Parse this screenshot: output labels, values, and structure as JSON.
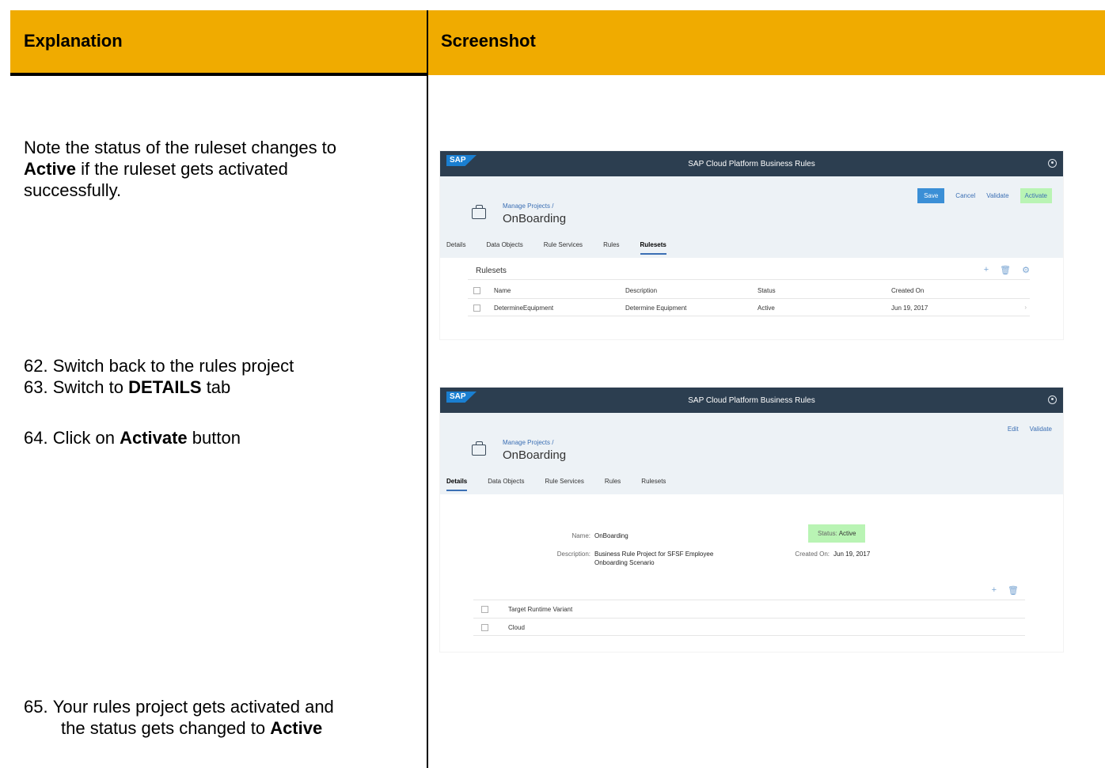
{
  "doc": {
    "header_explanation": "Explanation",
    "header_screenshot": "Screenshot",
    "note": {
      "prefix": "Note the status of the ruleset changes to",
      "bold": "Active",
      "suffix_line1": " if the ruleset gets activated",
      "line3": "successfully."
    },
    "steps": [
      {
        "num": "62.",
        "text": "Switch back to the rules project",
        "bold": "",
        "after": ""
      },
      {
        "num": "63.",
        "text": "Switch to ",
        "bold": "DETAILS",
        "after": " tab"
      },
      {
        "num": "64.",
        "text": "Click on ",
        "bold": "Activate",
        "after": " button"
      },
      {
        "num": "65.",
        "text": "Your rules project gets activated and",
        "line2": "the status gets changed to ",
        "bold": "Active"
      }
    ]
  },
  "app": {
    "logo": "SAP",
    "shell_title": "SAP Cloud Platform Business Rules",
    "breadcrumb": "Manage Projects /",
    "project_title": "OnBoarding",
    "tabs": [
      "Details",
      "Data Objects",
      "Rule Services",
      "Rules",
      "Rulesets"
    ]
  },
  "shot1": {
    "actions": {
      "save": "Save",
      "cancel": "Cancel",
      "validate": "Validate",
      "activate": "Activate"
    },
    "section_title": "Rulesets",
    "columns": [
      "Name",
      "Description",
      "Status",
      "Created On"
    ],
    "rows": [
      {
        "name": "DetermineEquipment",
        "description": "Determine Equipment",
        "status": "Active",
        "created_on": "Jun 19, 2017"
      }
    ],
    "toolbar_icons": [
      "add-icon",
      "delete-icon",
      "settings-icon"
    ]
  },
  "shot2": {
    "actions": {
      "edit": "Edit",
      "validate": "Validate"
    },
    "name_label": "Name:",
    "name_value": "OnBoarding",
    "description_label": "Description:",
    "description_line1": "Business Rule Project for SFSF Employee",
    "description_line2": "Onboarding Scenario",
    "status_label": "Status:",
    "status_value": "Active",
    "created_label": "Created On:",
    "created_value": "Jun 19, 2017",
    "table_header": "Target Runtime Variant",
    "table_rows": [
      "Cloud"
    ],
    "toolbar_icons": [
      "add-icon",
      "delete-icon"
    ]
  },
  "colors": {
    "header": "#f0ab00",
    "shell": "#2c3e50",
    "success": "#b9f4b4",
    "link": "#3b6fb4"
  }
}
